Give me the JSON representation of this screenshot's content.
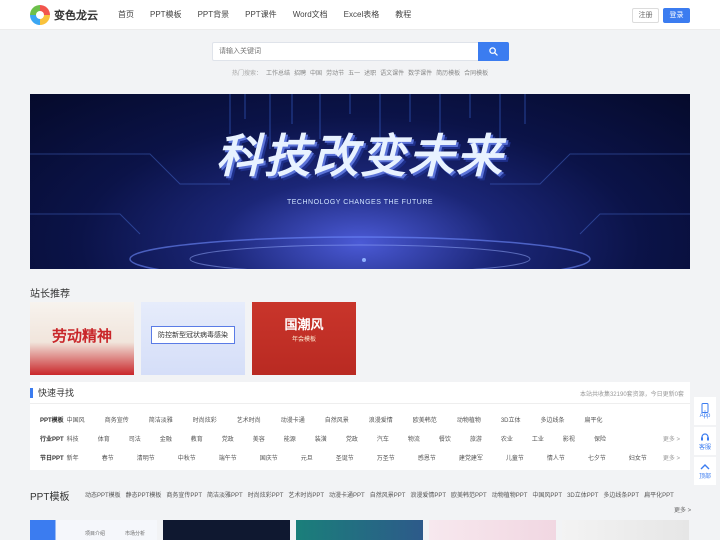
{
  "brand": {
    "name": "变色龙云"
  },
  "nav": [
    "首页",
    "PPT模板",
    "PPT背景",
    "PPT课件",
    "Word文档",
    "Excel表格",
    "教程"
  ],
  "auth": {
    "login": "注册",
    "register": "登录"
  },
  "search": {
    "placeholder": "请输入关键词",
    "hot_label": "热门搜索：",
    "hot": [
      "工作总结",
      "招聘",
      "中国",
      "劳动节",
      "五一",
      "述职",
      "语文课件",
      "数学课件",
      "简历模板",
      "合同模板"
    ]
  },
  "banner": {
    "title": "科技改变未来",
    "subtitle": "TECHNOLOGY CHANGES THE FUTURE"
  },
  "recommend": {
    "title": "站长推荐",
    "items": [
      {
        "title": "劳动精神"
      },
      {
        "title": "防控新型冠状病毒感染"
      },
      {
        "title": "国潮风",
        "sub": "年会模板"
      }
    ]
  },
  "quick": {
    "title": "快速寻找",
    "count_text": "本站共收集32190套资源，今日更新0套",
    "more": "更多 >",
    "rows": [
      {
        "label": "PPT模板",
        "items": [
          "中国风",
          "商务宣传",
          "简洁淡雅",
          "时尚炫彩",
          "艺术时尚",
          "动漫卡通",
          "自然风景",
          "浪漫爱情",
          "欧美韩范",
          "动物植物",
          "3D立体",
          "多边线条",
          "扁平化"
        ]
      },
      {
        "label": "行业PPT",
        "items": [
          "科技",
          "体育",
          "司法",
          "金融",
          "教育",
          "党政",
          "美容",
          "能源",
          "装潢",
          "党政",
          "汽车",
          "物流",
          "餐饮",
          "旅游",
          "农业",
          "工业",
          "影视",
          "保险"
        ]
      },
      {
        "label": "节日PPT",
        "items": [
          "新年",
          "春节",
          "清明节",
          "中秋节",
          "端午节",
          "国庆节",
          "元旦",
          "圣诞节",
          "万圣节",
          "感恩节",
          "建党建军",
          "儿童节",
          "情人节",
          "七夕节",
          "妇女节"
        ]
      }
    ]
  },
  "ppt": {
    "title": "PPT模板",
    "cats": [
      "动态PPT模板",
      "静态PPT模板",
      "商务宣传PPT",
      "简洁淡雅PPT",
      "时尚炫彩PPT",
      "艺术时尚PPT",
      "动漫卡通PPT",
      "自然风景PPT",
      "浪漫爱情PPT",
      "欧美韩范PPT",
      "动物植物PPT",
      "中国风PPT",
      "3D立体PPT",
      "多边线条PPT",
      "扁平化PPT"
    ],
    "more": "更多 >",
    "card1": [
      "项目介绍",
      "市场分析"
    ]
  },
  "side": [
    "App",
    "客服",
    "顶部"
  ]
}
